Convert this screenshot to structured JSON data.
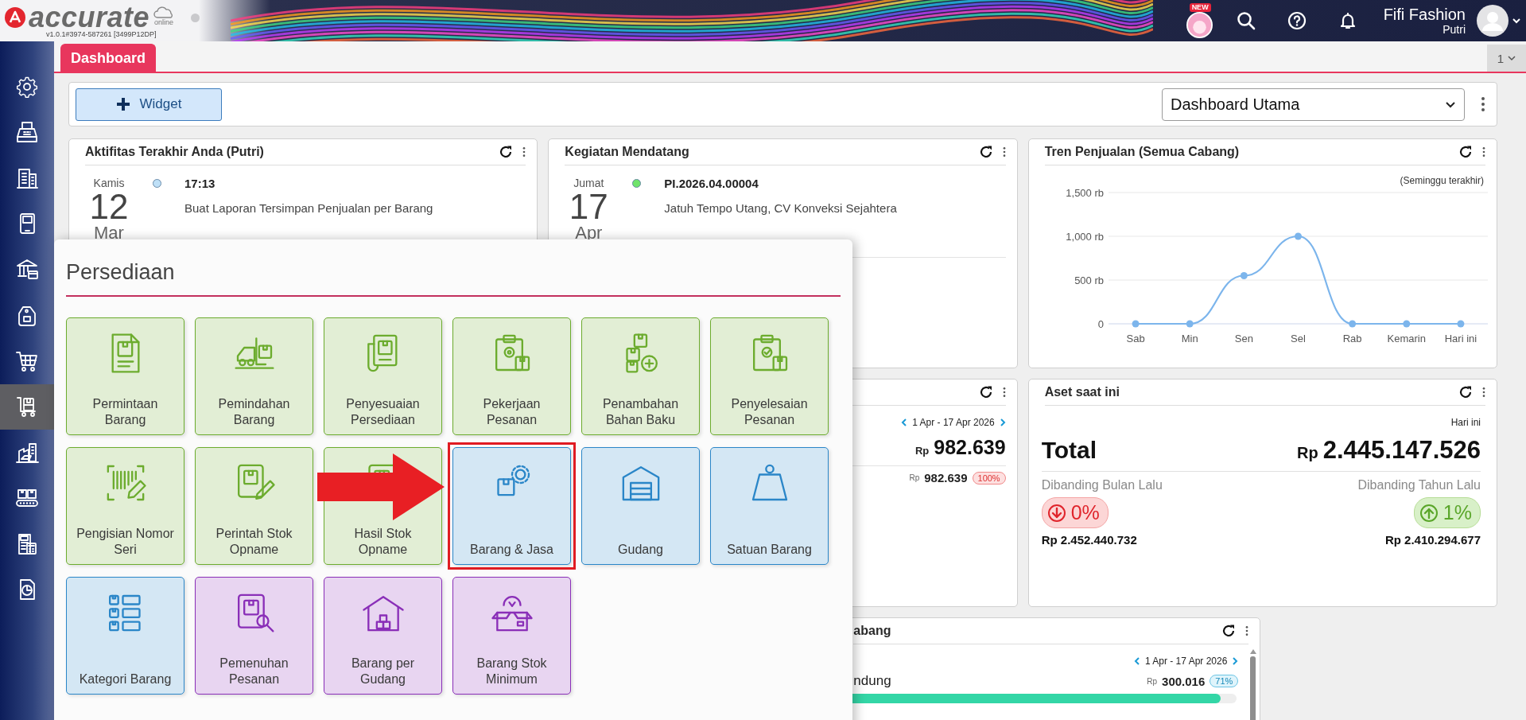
{
  "header": {
    "logo_text": "accurate",
    "logo_sub": "online",
    "version": "v1.0.1#3974-587261 [3499P12DP]",
    "new_badge": "NEW",
    "company": "Fifi Fashion",
    "user": "Putri"
  },
  "sidebar": {
    "items": [
      {
        "selected": false
      },
      {
        "selected": false
      },
      {
        "selected": false
      },
      {
        "selected": false
      },
      {
        "selected": false
      },
      {
        "selected": false
      },
      {
        "selected": false
      },
      {
        "selected": true
      },
      {
        "selected": false
      },
      {
        "selected": false
      },
      {
        "selected": false
      },
      {
        "selected": false
      }
    ]
  },
  "tabs": [
    {
      "label": "Dashboard",
      "selected": true
    }
  ],
  "tab_counter": "1",
  "toolbar": {
    "widget_button": "Widget",
    "dashboard_select": "Dashboard Utama"
  },
  "widgets": {
    "recent_activity": {
      "title": "Aktifitas Terakhir Anda (Putri)",
      "entries": [
        {
          "day": "Kamis",
          "date": "12",
          "month": "Mar",
          "color": "#bfe0f7",
          "time": "17:13",
          "text": "Buat Laporan Tersimpan Penjualan per Barang"
        }
      ]
    },
    "upcoming": {
      "title": "Kegiatan Mendatang",
      "entries": [
        {
          "day": "Jumat",
          "date": "17",
          "month": "Apr",
          "color": "#6fe36a",
          "time": "PI.2026.04.00004",
          "text": "Jatuh Tempo Utang, CV Konveksi Sejahtera"
        }
      ]
    },
    "sales_trend": {
      "title": "Tren Penjualan (Semua Cabang)",
      "period": "(Seminggu terakhir)",
      "chart_data": {
        "type": "line",
        "categories": [
          "Sab",
          "Min",
          "Sen",
          "Sel",
          "Rab",
          "Kemarin",
          "Hari ini"
        ],
        "series": [
          {
            "color": "#7cb5ec",
            "marker": true,
            "values": [
              0,
              0,
              550,
              1000,
              0,
              0,
              0
            ]
          }
        ],
        "ylim": [
          0,
          1500
        ],
        "yticks": [
          {
            "value": 0,
            "label": "0"
          },
          {
            "value": 500,
            "label": "500 rb"
          },
          {
            "value": 1000,
            "label": "1,000 rb"
          },
          {
            "value": 1500,
            "label": "1,500 rb"
          }
        ]
      }
    },
    "sales_summary": {
      "range": "1 Apr - 17 Apr 2026",
      "total": {
        "currency": "Rp",
        "amount": "982.639"
      },
      "rows": [
        {
          "currency": "Rp",
          "amount": "982.639",
          "share": "100%"
        }
      ]
    },
    "assets": {
      "title": "Aset saat ini",
      "period": "Hari ini",
      "total_label": "Total",
      "total": {
        "currency": "Rp",
        "amount": "2.445.147.526"
      },
      "comparisons": [
        {
          "label": "Dibanding Bulan Lalu",
          "kind": "down",
          "change": "0%",
          "amount": "Rp 2.452.440.732"
        },
        {
          "label": "Dibanding Tahun Lalu",
          "kind": "up",
          "change": "1%",
          "amount": "Rp 2.410.294.677"
        }
      ]
    },
    "branch_sales": {
      "title": "abang",
      "range": "1 Apr - 17 Apr 2026",
      "rows": [
        {
          "name": "ndung",
          "currency": "Rp",
          "amount": "300.016",
          "share": "71%",
          "level": 0.96
        }
      ]
    }
  },
  "popup": {
    "title": "Persediaan",
    "tiles": [
      {
        "label": "Permintaan Barang",
        "color": "#6cac2e",
        "highlighted": false
      },
      {
        "label": "Pemindahan Barang",
        "color": "#6cac2e",
        "highlighted": false
      },
      {
        "label": "Penyesuaian Persediaan",
        "color": "#6cac2e",
        "highlighted": false
      },
      {
        "label": "Pekerjaan Pesanan",
        "color": "#6cac2e",
        "highlighted": false
      },
      {
        "label": "Penambahan Bahan Baku",
        "color": "#6cac2e",
        "highlighted": false
      },
      {
        "label": "Penyelesaian Pesanan",
        "color": "#6cac2e",
        "highlighted": false
      },
      {
        "label": "Pengisian Nomor Seri",
        "color": "#6cac2e",
        "highlighted": false
      },
      {
        "label": "Perintah Stok Opname",
        "color": "#6cac2e",
        "highlighted": false
      },
      {
        "label": "Hasil Stok Opname",
        "color": "#6cac2e",
        "highlighted": false
      },
      {
        "label": "Barang & Jasa",
        "color": "#2a86c8",
        "highlighted": true
      },
      {
        "label": "Gudang",
        "color": "#2a86c8",
        "highlighted": false
      },
      {
        "label": "Satuan Barang",
        "color": "#2a86c8",
        "highlighted": false
      },
      {
        "label": "Kategori Barang",
        "color": "#2a86c8",
        "highlighted": false
      },
      {
        "label": "Pemenuhan Pesanan",
        "color": "#8a2fb8",
        "highlighted": false
      },
      {
        "label": "Barang per Gudang",
        "color": "#8a2fb8",
        "highlighted": false
      },
      {
        "label": "Barang Stok Minimum",
        "color": "#8a2fb8",
        "highlighted": false
      }
    ]
  }
}
